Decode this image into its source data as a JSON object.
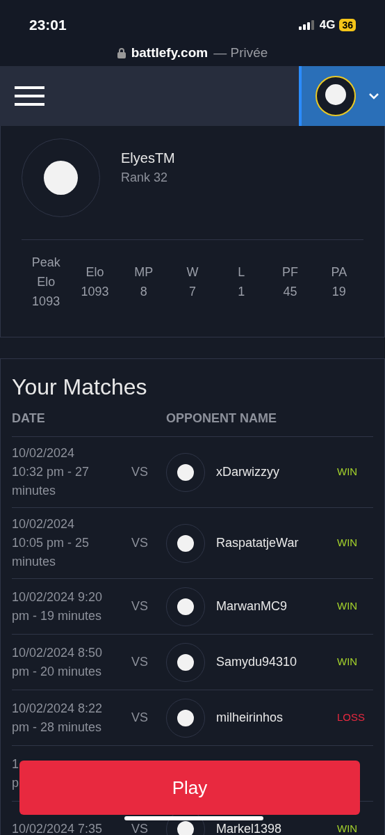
{
  "status_bar": {
    "time": "23:01",
    "network": "4G",
    "battery": "36"
  },
  "address_bar": {
    "domain": "battlefy.com",
    "suffix": "— Privée"
  },
  "profile": {
    "name": "ElyesTM",
    "rank": "Rank 32",
    "stats": [
      {
        "label": "Peak Elo",
        "value": "1093"
      },
      {
        "label": "Elo",
        "value": "1093"
      },
      {
        "label": "MP",
        "value": "8"
      },
      {
        "label": "W",
        "value": "7"
      },
      {
        "label": "L",
        "value": "1"
      },
      {
        "label": "PF",
        "value": "45"
      },
      {
        "label": "PA",
        "value": "19"
      }
    ]
  },
  "matches": {
    "title": "Your Matches",
    "columns": [
      "DATE",
      "OPPONENT NAME"
    ],
    "rows": [
      {
        "date_lines": [
          "10/02/2024",
          "10:32 pm - 27",
          "minutes"
        ],
        "vs": "VS",
        "opponent": "xDarwizzyy",
        "result": "WIN",
        "kind": "win"
      },
      {
        "date_lines": [
          "10/02/2024",
          "10:05 pm - 25",
          "minutes"
        ],
        "vs": "VS",
        "opponent": "RaspatatjeWar",
        "result": "WIN",
        "kind": "win"
      },
      {
        "date_lines": [
          "10/02/2024 9:20",
          "pm - 19 minutes"
        ],
        "vs": "VS",
        "opponent": "MarwanMC9",
        "result": "WIN",
        "kind": "win"
      },
      {
        "date_lines": [
          "10/02/2024 8:50",
          "pm - 20 minutes"
        ],
        "vs": "VS",
        "opponent": "Samydu94310",
        "result": "WIN",
        "kind": "win"
      },
      {
        "date_lines": [
          "10/02/2024 8:22",
          "pm - 28 minutes"
        ],
        "vs": "VS",
        "opponent": "milheirinhos",
        "result": "LOSS",
        "kind": "loss"
      },
      {
        "date_lines": [
          "1",
          "p"
        ]
      },
      {
        "date_lines": [
          "10/02/2024 7:35"
        ],
        "vs": "VS",
        "opponent": "Markel1398",
        "result": "WIN",
        "kind": "win"
      }
    ]
  },
  "play_button": "Play"
}
